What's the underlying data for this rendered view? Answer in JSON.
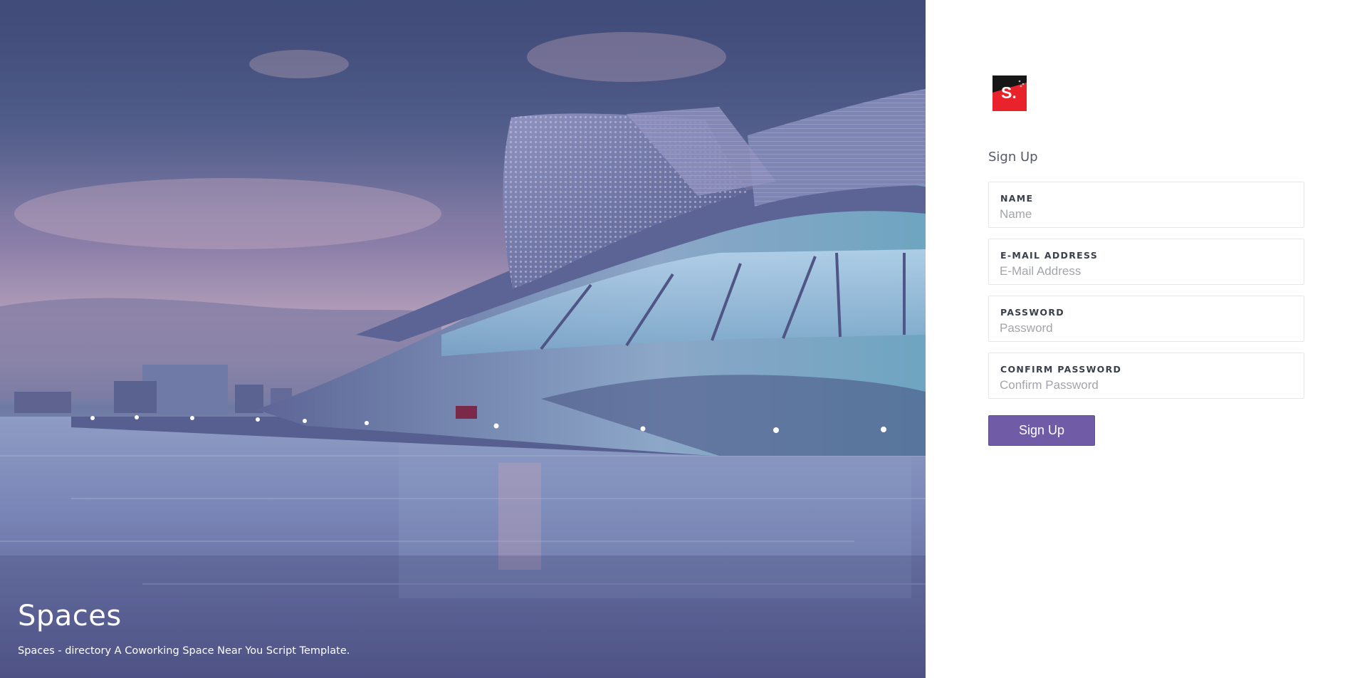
{
  "hero": {
    "title": "Spaces",
    "subtitle": "Spaces - directory A Coworking Space Near You Script Template."
  },
  "logo": {
    "letter": "S.",
    "icon": "brand-logo-icon",
    "colors": {
      "dark": "#161616",
      "red": "#e8232b"
    }
  },
  "form": {
    "title": "Sign Up",
    "fields": [
      {
        "label": "NAME",
        "placeholder": "Name",
        "value": ""
      },
      {
        "label": "E-MAIL ADDRESS",
        "placeholder": "E-Mail Address",
        "value": ""
      },
      {
        "label": "PASSWORD",
        "placeholder": "Password",
        "value": ""
      },
      {
        "label": "CONFIRM PASSWORD",
        "placeholder": "Confirm Password",
        "value": ""
      }
    ],
    "submit_label": "Sign Up"
  },
  "colors": {
    "accent": "#6f5ba6",
    "label_text": "#3a3f4a",
    "placeholder_text": "#a2a5ab"
  }
}
